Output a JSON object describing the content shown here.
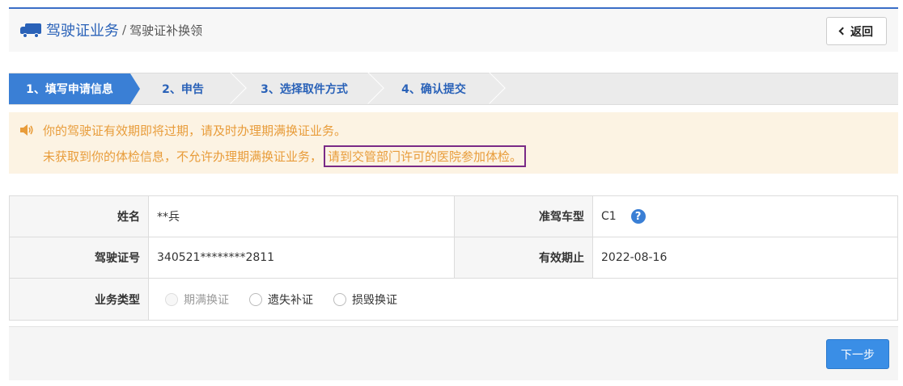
{
  "header": {
    "truck_icon": "truck-icon",
    "title": "驾驶证业务",
    "separator": "/",
    "subtitle": "驾驶证补换领",
    "back_label": "返回"
  },
  "steps": [
    {
      "label": "1、填写申请信息",
      "active": true
    },
    {
      "label": "2、申告",
      "active": false
    },
    {
      "label": "3、选择取件方式",
      "active": false
    },
    {
      "label": "4、确认提交",
      "active": false
    }
  ],
  "alert": {
    "icon": "speaker-icon",
    "line1": "你的驾驶证有效期即将过期，请及时办理期满换证业务。",
    "line2_prefix": "未获取到你的体检信息，不允许办理期满换证业务，",
    "line2_highlight": "请到交管部门许可的医院参加体检。",
    "color": "#e89c3a"
  },
  "form": {
    "name_label": "姓名",
    "name_value": "**兵",
    "vehicle_type_label": "准驾车型",
    "vehicle_type_value": "C1",
    "help_icon": "?",
    "license_no_label": "驾驶证号",
    "license_no_value": "340521********2811",
    "expiry_label": "有效期止",
    "expiry_value": "2022-08-16",
    "business_type_label": "业务类型",
    "business_options": [
      {
        "label": "期满换证",
        "disabled": true
      },
      {
        "label": "遗失补证",
        "disabled": false
      },
      {
        "label": "损毁换证",
        "disabled": false
      }
    ]
  },
  "footer": {
    "next_label": "下一步"
  },
  "colors": {
    "primary": "#3a7fd5",
    "brand_text": "#2a62b8",
    "alert_bg": "#fcf3e3",
    "highlight_border": "#7a2a86"
  }
}
